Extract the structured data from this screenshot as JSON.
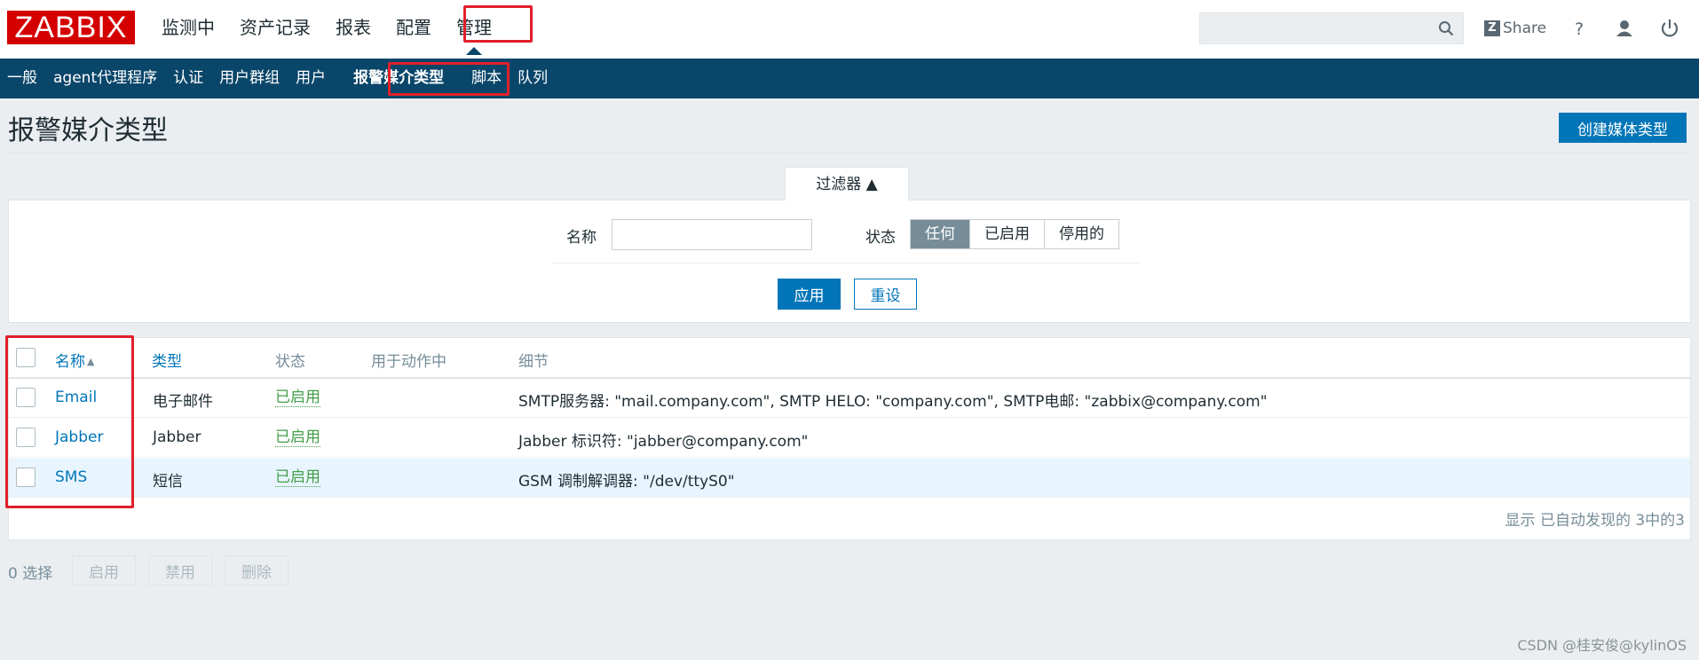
{
  "header": {
    "logo": "ZABBIX",
    "nav": [
      "监测中",
      "资产记录",
      "报表",
      "配置",
      "管理"
    ],
    "search_placeholder": "",
    "share_label": "Share",
    "icons": [
      "search-icon",
      "help-icon",
      "user-icon",
      "power-icon"
    ]
  },
  "subnav": [
    "一般",
    "agent代理程序",
    "认证",
    "用户群组",
    "用户",
    "报警媒介类型",
    "脚本",
    "队列"
  ],
  "page": {
    "title": "报警媒介类型",
    "create_button": "创建媒体类型"
  },
  "filter": {
    "tab_label": "过滤器 ▲",
    "name_label": "名称",
    "name_value": "",
    "status_label": "状态",
    "status_options": [
      "任何",
      "已启用",
      "停用的"
    ],
    "status_selected": "任何",
    "apply_button": "应用",
    "reset_button": "重设"
  },
  "table": {
    "columns": [
      "名称",
      "类型",
      "状态",
      "用于动作中",
      "细节"
    ],
    "sort_arrow": "▲",
    "rows": [
      {
        "name": "Email",
        "type": "电子邮件",
        "status": "已启用",
        "used_in": "",
        "details": "SMTP服务器: \"mail.company.com\", SMTP HELO: \"company.com\", SMTP电邮: \"zabbix@company.com\""
      },
      {
        "name": "Jabber",
        "type": "Jabber",
        "status": "已启用",
        "used_in": "",
        "details": "Jabber 标识符: \"jabber@company.com\""
      },
      {
        "name": "SMS",
        "type": "短信",
        "status": "已启用",
        "used_in": "",
        "details": "GSM 调制解调器: \"/dev/ttyS0\""
      }
    ],
    "summary": "显示 已自动发现的 3中的3"
  },
  "footer": {
    "selected": "0 选择",
    "buttons": [
      "启用",
      "禁用",
      "删除"
    ]
  },
  "watermark": "CSDN @桂安俊@kylinOS",
  "colors": {
    "brand": "#d40000",
    "subnav_bg": "#0a466a",
    "primary": "#0275b8",
    "enabled": "#429e47",
    "annotation": "#e0202a"
  }
}
